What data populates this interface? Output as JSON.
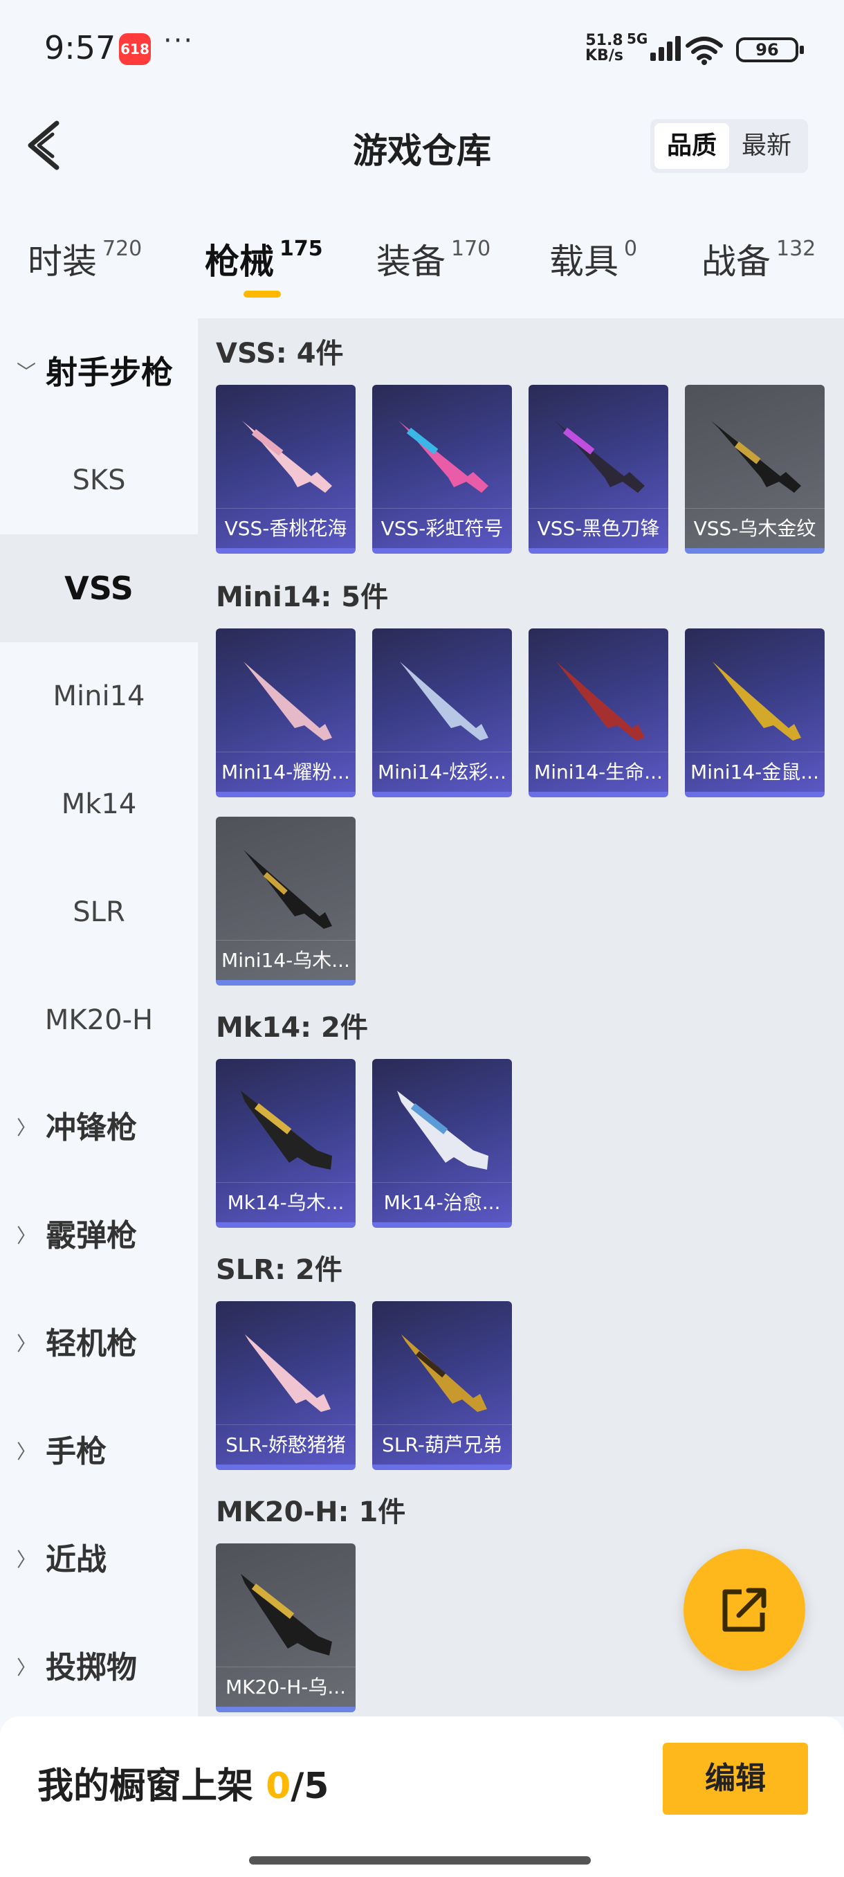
{
  "status": {
    "time": "9:57",
    "app_badge": "618",
    "more": "···",
    "net_speed_top": "51.8",
    "net_speed_bottom": "KB/s",
    "network": "5G",
    "battery": "96"
  },
  "header": {
    "title": "游戏仓库",
    "sort_options": [
      "品质",
      "最新"
    ]
  },
  "tabs": [
    {
      "label": "时装",
      "count": "720"
    },
    {
      "label": "枪械",
      "count": "175"
    },
    {
      "label": "装备",
      "count": "170"
    },
    {
      "label": "载具",
      "count": "0"
    },
    {
      "label": "战备",
      "count": "132"
    }
  ],
  "sidebar": {
    "open_group": "射手步枪",
    "items": [
      "SKS",
      "VSS",
      "Mini14",
      "Mk14",
      "SLR",
      "MK20-H"
    ],
    "groups": [
      "冲锋枪",
      "霰弹枪",
      "轻机枪",
      "手枪",
      "近战",
      "投掷物"
    ]
  },
  "sections": [
    {
      "title": "VSS: 4件",
      "items": [
        "VSS-香桃花海",
        "VSS-彩虹符号",
        "VSS-黑色刀锋",
        "VSS-乌木金纹"
      ]
    },
    {
      "title": "Mini14: 5件",
      "items": [
        "Mini14-耀粉...",
        "Mini14-炫彩...",
        "Mini14-生命...",
        "Mini14-金鼠...",
        "Mini14-乌木..."
      ]
    },
    {
      "title": "Mk14: 2件",
      "items": [
        "Mk14-乌木...",
        "Mk14-治愈..."
      ]
    },
    {
      "title": "SLR: 2件",
      "items": [
        "SLR-娇憨猪猪",
        "SLR-葫芦兄弟"
      ]
    },
    {
      "title": "MK20-H: 1件",
      "items": [
        "MK20-H-乌..."
      ]
    }
  ],
  "bottom": {
    "shelf_label": "我的橱窗上架",
    "shelf_current": "0",
    "shelf_total": "/5",
    "edit_label": "编辑"
  },
  "colors": {
    "accent": "#ffb81c",
    "card_purple": "#3a3d86",
    "card_grey": "#5d6068"
  }
}
